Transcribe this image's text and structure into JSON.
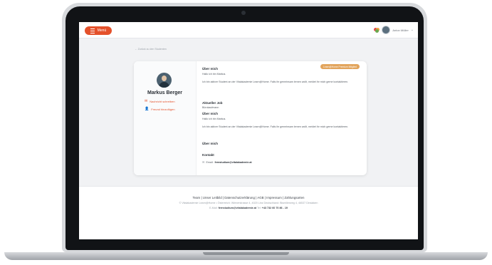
{
  "topbar": {
    "menu_label": "Menü",
    "user_name": "Anton Müller"
  },
  "back_link": "← Zurück zu den Studenten",
  "profile": {
    "name": "Markus Berger",
    "message_label": "Nachricht schreiben",
    "friend_label": "Freund hinzufügen"
  },
  "badge": "Learn@Home Premium Mitglied",
  "sections": {
    "about_title": "Über mich",
    "about_greeting": "Hallo ich bin Markus.",
    "about_text": "Ich bin aktiver Student an der Vitalakademie Learn@Home. Falls ihr gemeinsam lernen wollt, meldet ihr mich gerne kontaktieren.",
    "job_title": "Aktueller Job",
    "job_value": "Bürokaufmann",
    "about2_title": "Über mich",
    "about2_greeting": "Hallo ich bin Markus.",
    "about2_text": "Ich bin aktiver Student an der Vitalakademie Learn@Home. Falls ihr gemeinsam lernen wollt, meldet ihr mich gerne kontaktieren.",
    "about3_title": "Über mich",
    "contact_title": "Kontakt",
    "contact_label": "Email:",
    "contact_email": "fernstudium@vitalakademie.at"
  },
  "footer": {
    "links": "Team | Unser Leitbild | Datenschutzerklärung | AGB | Impressum | Zahlungsarten",
    "address": "© Vitalakademie Learn@Home • Österreich: Wienerstrasse 4, 4020 Linz Deutschland: Bismillerweg 4, 46537 Dinslaken",
    "contact_prefix": "E-Mail:",
    "contact_email": "fernstudium@vitalakademie.at",
    "phone_prefix": "Tel:",
    "phone": "+43 732 60 70 86 - 19"
  },
  "icons": {
    "menu": "hamburger-icon",
    "heart": "heart-icon",
    "chevron": "chevron-down-icon",
    "message": "chat-icon",
    "friend": "add-user-icon",
    "mail": "mail-icon"
  },
  "colors": {
    "accent": "#e4512b",
    "badge": "#e2a45c"
  }
}
